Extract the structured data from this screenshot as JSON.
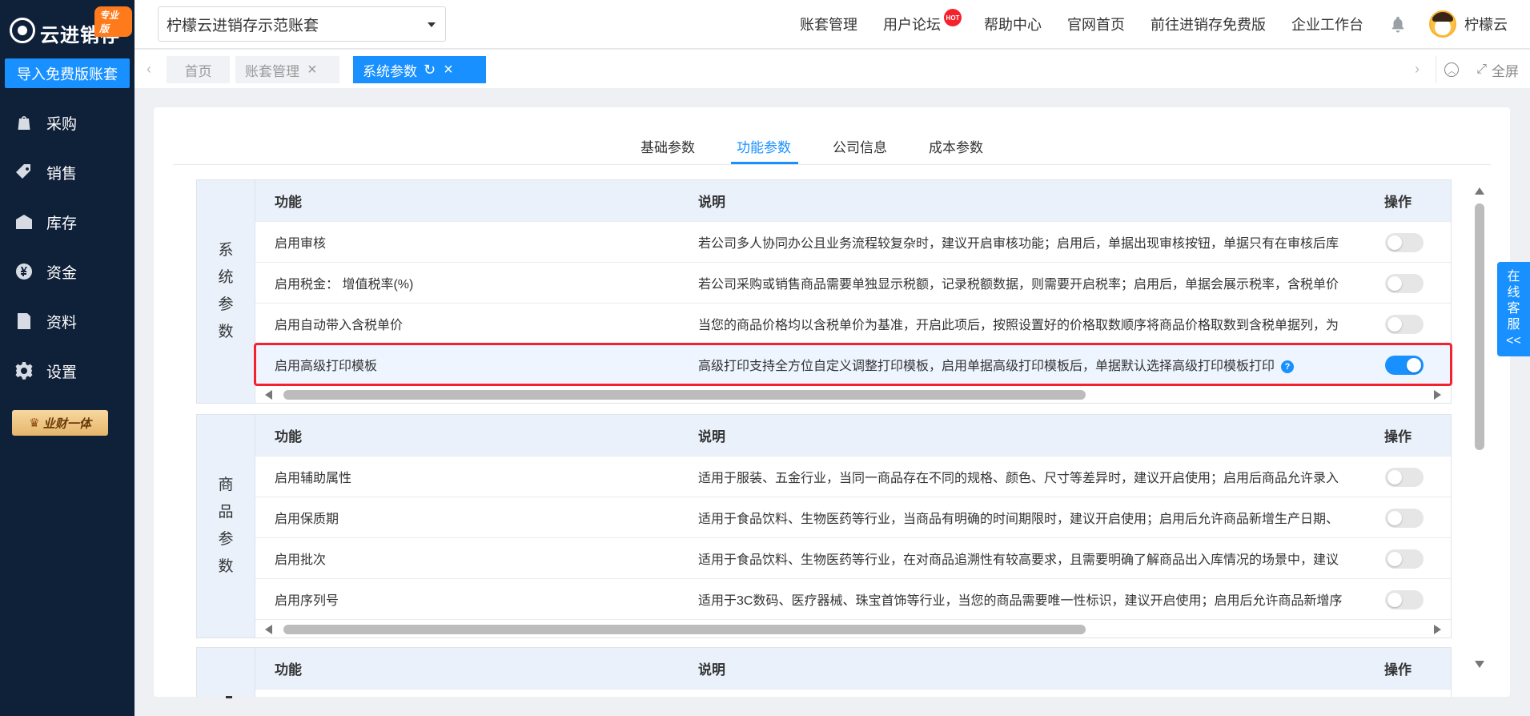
{
  "brand": {
    "name": "云进销存",
    "badge": "专业版"
  },
  "sidebar": {
    "import_button": "导入免费版账套",
    "items": [
      {
        "label": "采购",
        "icon": "bag-icon"
      },
      {
        "label": "销售",
        "icon": "coin-tag-icon"
      },
      {
        "label": "库存",
        "icon": "warehouse-icon"
      },
      {
        "label": "资金",
        "icon": "yen-icon"
      },
      {
        "label": "资料",
        "icon": "document-icon"
      },
      {
        "label": "设置",
        "icon": "gear-icon"
      }
    ],
    "promo": "业财一体"
  },
  "header": {
    "account_select": "柠檬云进销存示范账套",
    "links": [
      "账套管理",
      "用户论坛",
      "帮助中心",
      "官网首页",
      "前往进销存免费版",
      "企业工作台"
    ],
    "hot_badge": "HOT",
    "username": "柠檬云"
  },
  "tabs": {
    "items": [
      {
        "label": "首页"
      },
      {
        "label": "账套管理"
      },
      {
        "label": "系统参数"
      }
    ],
    "fullscreen": "全屏"
  },
  "subtabs": [
    "基础参数",
    "功能参数",
    "公司信息",
    "成本参数"
  ],
  "table_headers": {
    "func": "功能",
    "desc": "说明",
    "op": "操作"
  },
  "sections": [
    {
      "label": [
        "系",
        "统",
        "参",
        "数"
      ],
      "rows": [
        {
          "func": "启用审核",
          "desc": "若公司多人协同办公且业务流程较复杂时，建议开启审核功能；启用后，单据出现审核按钮，单据只有在审核后库",
          "on": false
        },
        {
          "func": "启用税金： 增值税率(%)",
          "desc": "若公司采购或销售商品需要单独显示税额，记录税额数据，则需要开启税率；启用后，单据会展示税率，含税单价",
          "on": false
        },
        {
          "func": "启用自动带入含税单价",
          "desc": "当您的商品价格均以含税单价为基准，开启此项后，按照设置好的价格取数顺序将商品价格取数到含税单据列，为",
          "on": false
        },
        {
          "func": "启用高级打印模板",
          "desc": "高级打印支持全方位自定义调整打印模板，启用单据高级打印模板后，单据默认选择高级打印模板打印",
          "on": true
        }
      ]
    },
    {
      "label": [
        "商",
        "品",
        "参",
        "数"
      ],
      "rows": [
        {
          "func": "启用辅助属性",
          "desc": "适用于服装、五金行业，当同一商品存在不同的规格、颜色、尺寸等差异时，建议开启使用；启用后商品允许录入",
          "on": false
        },
        {
          "func": "启用保质期",
          "desc": "适用于食品饮料、生物医药等行业，当商品有明确的时间期限时，建议开启使用；启用后允许商品新增生产日期、",
          "on": false
        },
        {
          "func": "启用批次",
          "desc": "适用于食品饮料、生物医药等行业，在对商品追溯性有较高要求，且需要明确了解商品出入库情况的场景中，建议",
          "on": false
        },
        {
          "func": "启用序列号",
          "desc": "适用于3C数码、医疗器械、珠宝首饰等行业，当您的商品需要唯一性标识，建议开启使用；启用后允许商品新增序",
          "on": false
        }
      ]
    }
  ],
  "service": [
    "在",
    "线",
    "客",
    "服",
    "<<"
  ]
}
